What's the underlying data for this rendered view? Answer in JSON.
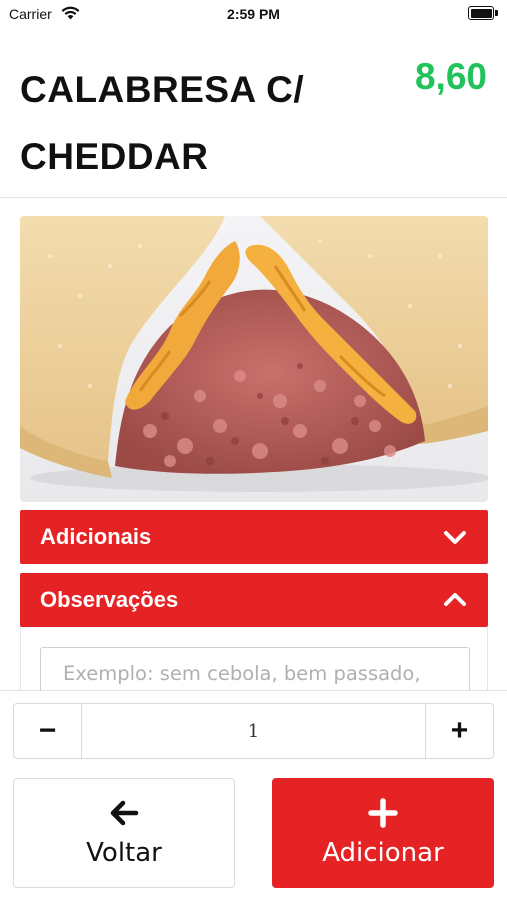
{
  "status_bar": {
    "carrier": "Carrier",
    "time": "2:59 PM",
    "battery_level": 1.0
  },
  "product": {
    "title": "CALABRESA C/ CHEDDAR",
    "price": "8,60",
    "price_color": "#21c25a",
    "image": "pastel-calabresa-cheddar"
  },
  "sections": {
    "adicionais": {
      "label": "Adicionais",
      "icon": "chevron-down-icon",
      "expanded": false
    },
    "observacoes": {
      "label": "Observações",
      "icon": "chevron-up-icon",
      "expanded": true,
      "placeholder": "Exemplo: sem cebola, bem passado, "
    }
  },
  "quantity": {
    "decrement_label": "−",
    "value": "1",
    "increment_label": "+"
  },
  "actions": {
    "back": {
      "label": "Voltar",
      "icon": "arrow-left-icon"
    },
    "add": {
      "label": "Adicionar",
      "icon": "plus-icon"
    }
  },
  "colors": {
    "accent_red": "#e52224",
    "price_green": "#21c25a"
  }
}
